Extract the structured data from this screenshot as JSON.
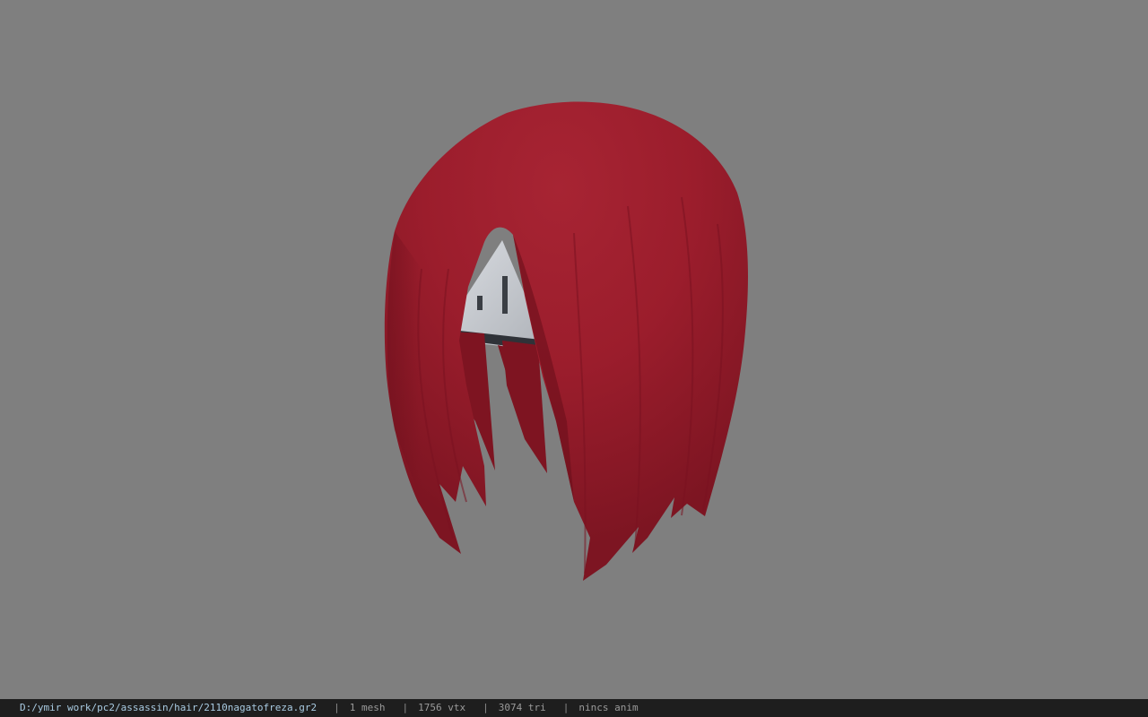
{
  "viewer": {
    "background_color": "#7f7f7f",
    "model_color": "#a3212f",
    "model_description": "red hair mesh"
  },
  "status_bar": {
    "file_path": "D:/ymir work/pc2/assassin/hair/2110nagatofreza.gr2",
    "separator": "|",
    "mesh_count": "1 mesh",
    "vertex_count": "1756 vtx",
    "triangle_count": "3074 tri",
    "animation": "nincs anim"
  }
}
